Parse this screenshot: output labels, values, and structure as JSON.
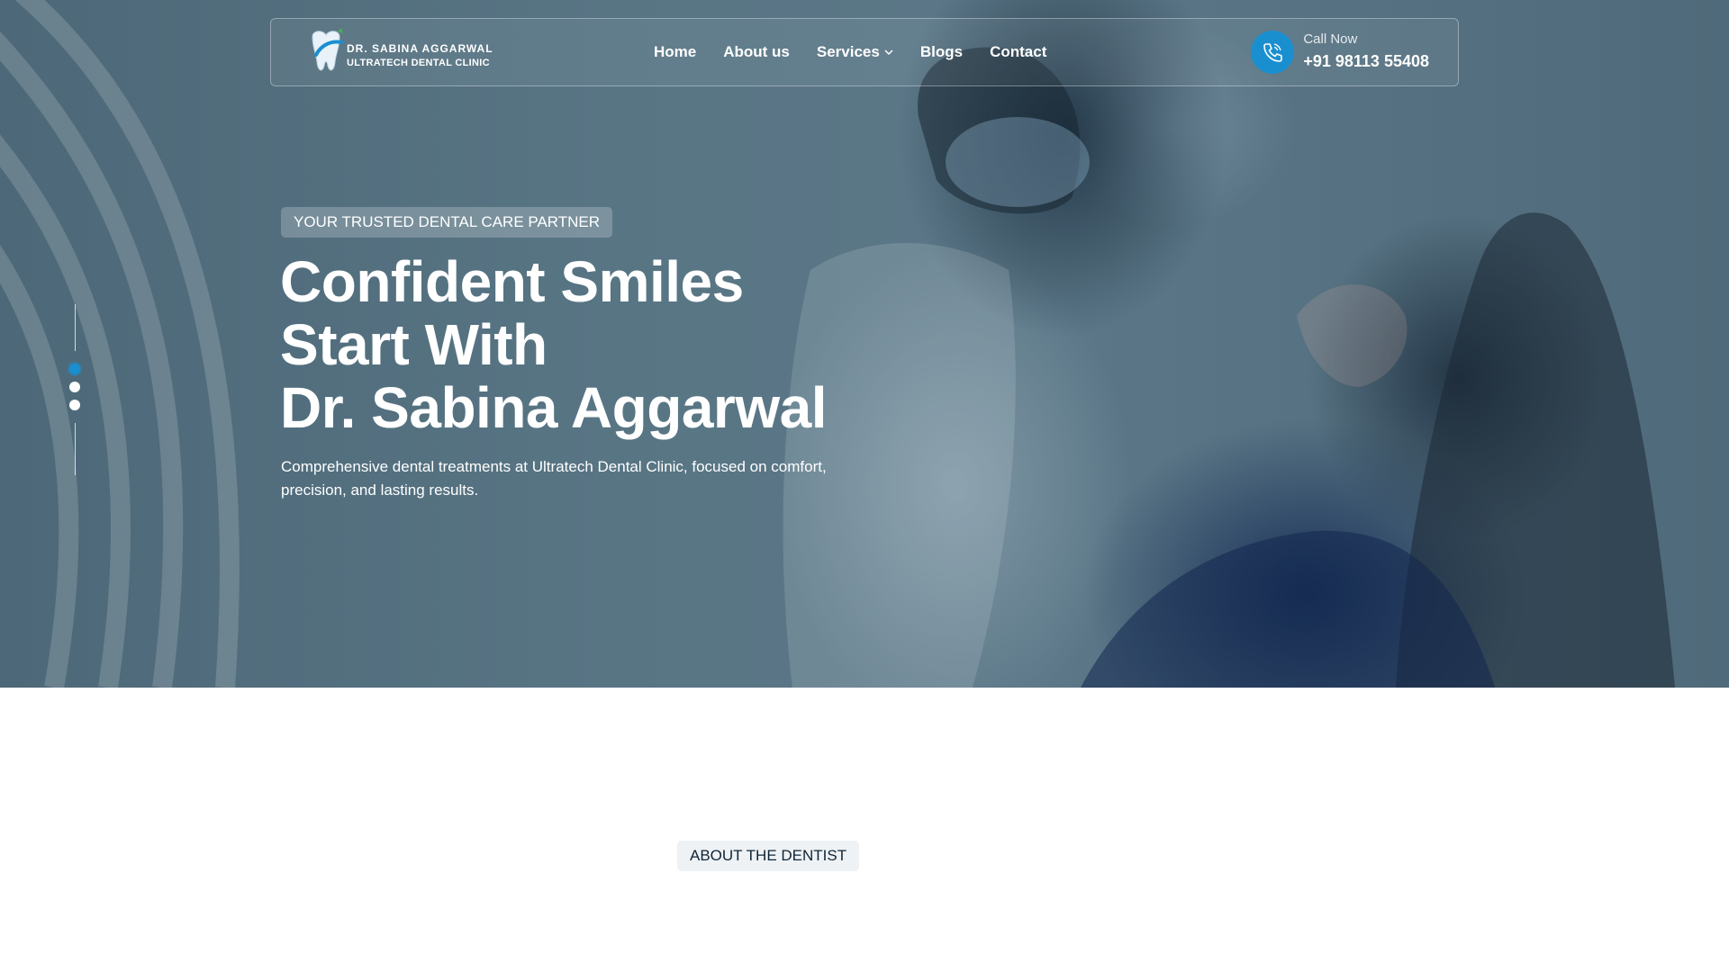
{
  "brand": {
    "line1": "DR. SABINA AGGARWAL",
    "line2": "ULTRATECH DENTAL CLINIC"
  },
  "nav": {
    "items": [
      {
        "label": "Home"
      },
      {
        "label": "About us"
      },
      {
        "label": "Services"
      },
      {
        "label": "Blogs"
      },
      {
        "label": "Contact"
      }
    ]
  },
  "call": {
    "label": "Call Now",
    "number": "+91 98113 55408"
  },
  "hero": {
    "badge": "YOUR TRUSTED DENTAL CARE PARTNER",
    "title_lines": [
      "Confident Smiles",
      "Start With",
      "Dr. Sabina Aggarwal"
    ],
    "description": "Comprehensive dental treatments at Ultratech Dental Clinic, focused on comfort, precision, and lasting results.",
    "slides": {
      "count": 3,
      "active": 1
    }
  },
  "about": {
    "badge": "ABOUT THE DENTIST"
  },
  "colors": {
    "accent": "#1a8fd0",
    "hero_overlay": "#587584",
    "about_badge_bg": "#eef2f5",
    "dark_text": "#0f2436"
  },
  "icons": {
    "logo": "tooth-logo-icon",
    "phone": "phone-icon",
    "dropdown": "chevron-down-icon"
  }
}
